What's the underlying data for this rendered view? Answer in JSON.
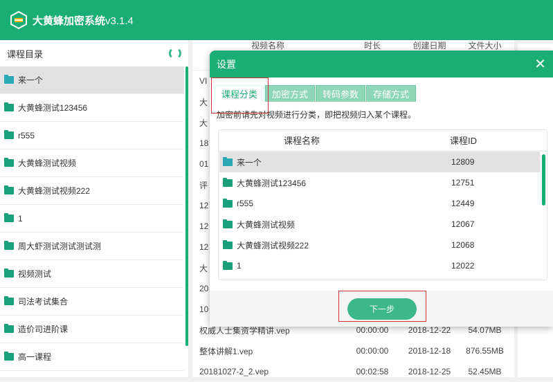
{
  "app": {
    "title": "大黄蜂加密系统",
    "version": "v3.1.4"
  },
  "sidebar": {
    "title": "课程目录",
    "items": [
      {
        "label": "来一个"
      },
      {
        "label": "大黄蜂测试123456"
      },
      {
        "label": "r555"
      },
      {
        "label": "大黄蜂测试视频"
      },
      {
        "label": "大黄蜂测试视频222"
      },
      {
        "label": "1"
      },
      {
        "label": "周大虾测试测试测试测"
      },
      {
        "label": "视频测试"
      },
      {
        "label": "司法考试集合"
      },
      {
        "label": "造价司进阶课"
      },
      {
        "label": "高一课程"
      }
    ]
  },
  "main": {
    "columns": [
      "视频名称",
      "时长",
      "创建日期",
      "文件大小"
    ],
    "rows": [
      {
        "name": "VI",
        "dur": "",
        "date": "",
        "size": ""
      },
      {
        "name": "大",
        "dur": "",
        "date": "",
        "size": ""
      },
      {
        "name": "大",
        "dur": "",
        "date": "",
        "size": ""
      },
      {
        "name": "18",
        "dur": "",
        "date": "",
        "size": ""
      },
      {
        "name": "01",
        "dur": "",
        "date": "",
        "size": ""
      },
      {
        "name": "评",
        "dur": "",
        "date": "",
        "size": ""
      },
      {
        "name": "12",
        "dur": "",
        "date": "",
        "size": ""
      },
      {
        "name": "12",
        "dur": "",
        "date": "",
        "size": ""
      },
      {
        "name": "12",
        "dur": "",
        "date": "",
        "size": ""
      },
      {
        "name": "大",
        "dur": "",
        "date": "",
        "size": ""
      },
      {
        "name": "20",
        "dur": "",
        "date": "",
        "size": ""
      },
      {
        "name": "10",
        "dur": "",
        "date": "",
        "size": ""
      },
      {
        "name": "权威人士集资学精讲.vep",
        "dur": "00:00:00",
        "date": "2018-12-22",
        "size": "54.07MB"
      },
      {
        "name": "整体讲解1.vep",
        "dur": "00:00:00",
        "date": "2018-12-18",
        "size": "876.55MB"
      },
      {
        "name": "20181027-2_2.vep",
        "dur": "00:02:58",
        "date": "2018-12-25",
        "size": "52.45MB"
      }
    ]
  },
  "dialog": {
    "title": "设置",
    "close": "✕",
    "tabs": [
      {
        "label": "课程分类"
      },
      {
        "label": "加密方式"
      },
      {
        "label": "转码参数"
      },
      {
        "label": "存储方式"
      }
    ],
    "description": "加密前请先对视频进行分类，即把视频归入某个课程。",
    "table": {
      "col_name": "课程名称",
      "col_id": "课程ID",
      "rows": [
        {
          "name": "来一个",
          "id": "12809"
        },
        {
          "name": "大黄蜂测试123456",
          "id": "12751"
        },
        {
          "name": "r555",
          "id": "12449"
        },
        {
          "name": "大黄蜂测试视频",
          "id": "12067"
        },
        {
          "name": "大黄蜂测试视频222",
          "id": "12068"
        },
        {
          "name": "1",
          "id": "12022"
        }
      ]
    },
    "next_label": "下一步"
  },
  "colors": {
    "brand": "#1aad75",
    "highlight": "#cc3333"
  }
}
